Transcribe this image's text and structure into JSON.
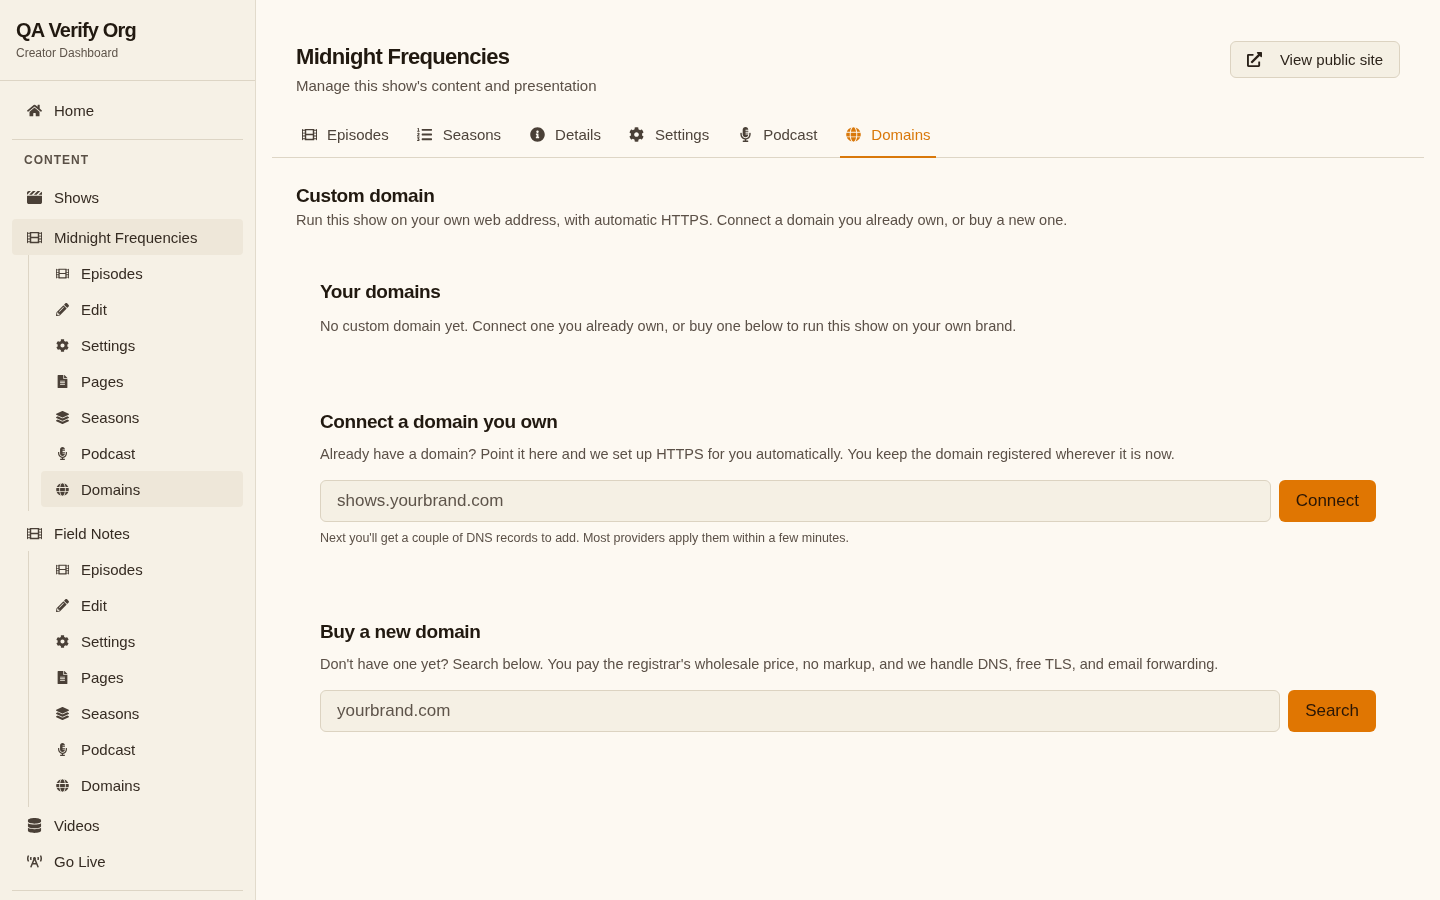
{
  "sidebar": {
    "org_name": "QA Verify Org",
    "org_subtitle": "Creator Dashboard",
    "top_items": [
      {
        "label": "Home",
        "kind": "home",
        "selected": false
      }
    ],
    "sections": [
      {
        "heading": "CONTENT",
        "items": [
          {
            "label": "Shows",
            "kind": "shows",
            "selected": false
          },
          {
            "label": "Midnight Frequencies",
            "kind": "show",
            "selected": true,
            "children": [
              {
                "label": "Episodes",
                "kind": "episodes",
                "selected": false
              },
              {
                "label": "Edit",
                "kind": "edit",
                "selected": false
              },
              {
                "label": "Settings",
                "kind": "settings",
                "selected": false
              },
              {
                "label": "Pages",
                "kind": "pages",
                "selected": false
              },
              {
                "label": "Seasons",
                "kind": "seasons",
                "selected": false
              },
              {
                "label": "Podcast",
                "kind": "podcast",
                "selected": false
              },
              {
                "label": "Domains",
                "kind": "domains",
                "selected": true
              }
            ]
          },
          {
            "label": "Field Notes",
            "kind": "show",
            "selected": false,
            "children": [
              {
                "label": "Episodes",
                "kind": "episodes",
                "selected": false
              },
              {
                "label": "Edit",
                "kind": "edit",
                "selected": false
              },
              {
                "label": "Settings",
                "kind": "settings",
                "selected": false
              },
              {
                "label": "Pages",
                "kind": "pages",
                "selected": false
              },
              {
                "label": "Seasons",
                "kind": "seasons",
                "selected": false
              },
              {
                "label": "Podcast",
                "kind": "podcast",
                "selected": false
              },
              {
                "label": "Domains",
                "kind": "domains",
                "selected": false
              }
            ]
          },
          {
            "label": "Videos",
            "kind": "videos",
            "selected": false
          },
          {
            "label": "Go Live",
            "kind": "live",
            "selected": false
          }
        ]
      }
    ]
  },
  "header": {
    "title": "Midnight Frequencies",
    "subtitle": "Manage this show's content and presentation",
    "action": "View public site"
  },
  "tabs": [
    {
      "label": "Episodes",
      "kind": "episodes",
      "selected": false
    },
    {
      "label": "Seasons",
      "kind": "seasons",
      "selected": false
    },
    {
      "label": "Details",
      "kind": "details",
      "selected": false
    },
    {
      "label": "Settings",
      "kind": "settings",
      "selected": false
    },
    {
      "label": "Podcast",
      "kind": "podcast",
      "selected": false
    },
    {
      "label": "Domains",
      "kind": "domains",
      "selected": true
    }
  ],
  "custom_domain": {
    "heading": "Custom domain",
    "description": "Run this show on your own web address, with automatic HTTPS. Connect a domain you already own, or buy a new one.",
    "panels": [
      {
        "kind": "info",
        "heading": "Your domains",
        "text": "No custom domain yet. Connect one you already own, or buy one below to run this show on your own brand."
      },
      {
        "kind": "form",
        "heading": "Connect a domain you own",
        "text": "Already have a domain? Point it here and we set up HTTPS for you automatically. You keep the domain registered wherever it is now.",
        "field": {
          "placeholder": "shows.yourbrand.com"
        },
        "button": "Connect",
        "hint": "Next you'll get a couple of DNS records to add. Most providers apply them within a few minutes."
      },
      {
        "kind": "form",
        "heading": "Buy a new domain",
        "text": "Don't have one yet? Search below. You pay the registrar's wholesale price, no markup, and we handle DNS, free TLS, and email forwarding.",
        "field": {
          "placeholder": "yourbrand.com"
        },
        "button": "Search"
      }
    ]
  }
}
